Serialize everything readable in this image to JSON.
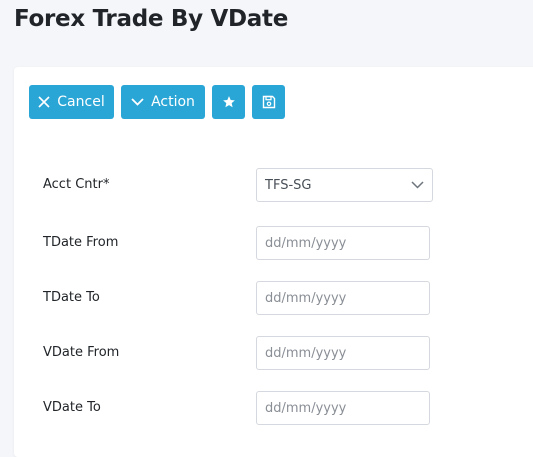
{
  "page": {
    "title": "Forex Trade By VDate"
  },
  "toolbar": {
    "cancel_label": "Cancel",
    "cancel_icon": "close-icon",
    "action_label": "Action",
    "action_icon": "chevron-down-icon",
    "favorite_icon": "star-icon",
    "save_icon": "save-icon",
    "accent_color": "#2aa6d6"
  },
  "form": {
    "acct_cntr": {
      "label": "Acct Cntr*",
      "value": "TFS-SG"
    },
    "tdate_from": {
      "label": "TDate From",
      "placeholder": "dd/mm/yyyy"
    },
    "tdate_to": {
      "label": "TDate To",
      "placeholder": "dd/mm/yyyy"
    },
    "vdate_from": {
      "label": "VDate From",
      "placeholder": "dd/mm/yyyy"
    },
    "vdate_to": {
      "label": "VDate To",
      "placeholder": "dd/mm/yyyy"
    }
  }
}
